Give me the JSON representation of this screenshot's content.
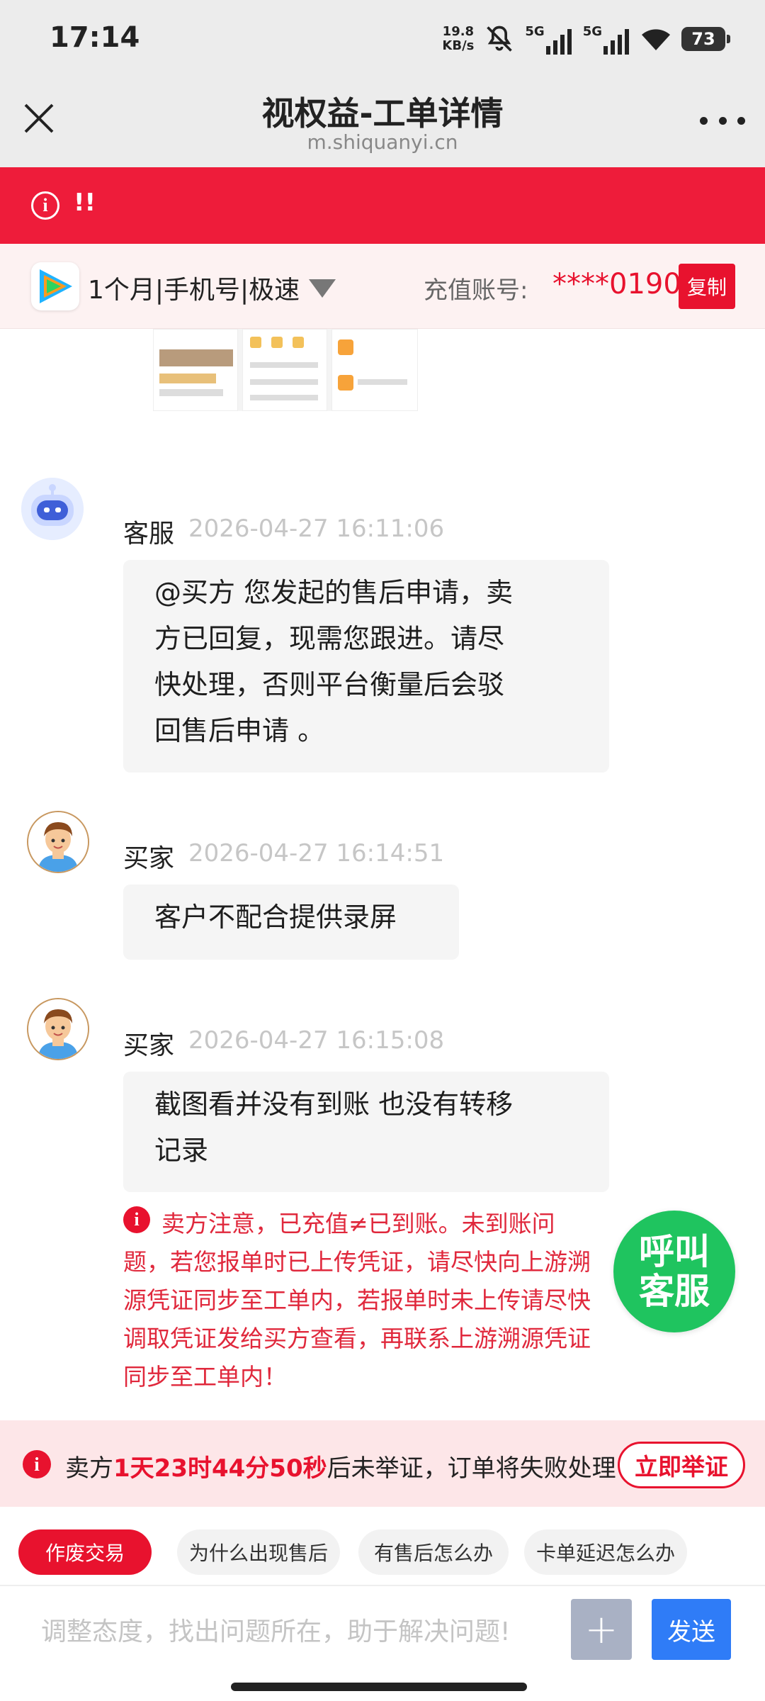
{
  "status_bar": {
    "time": "17:14",
    "net_speed_value": "19.8",
    "net_speed_unit": "KB/s",
    "sim1": "5G",
    "sim2": "5G",
    "battery": "73"
  },
  "header": {
    "title": "视权益-工单详情",
    "url": "m.shiquanyi.cn"
  },
  "alert": {
    "text": "!!"
  },
  "product": {
    "name": "1个月|手机号|极速",
    "account_label": "充值账号:",
    "account_value": "****0190",
    "copy_label": "复制"
  },
  "messages": [
    {
      "sender": "客服",
      "time": "2026-04-27 16:11:06",
      "lines": [
        "@买方 您发起的售后申请，卖",
        "方已回复，现需您跟进。请尽",
        "快处理，否则平台衡量后会驳",
        "回售后申请 。"
      ]
    },
    {
      "sender": "买家",
      "time": "2026-04-27 16:14:51",
      "lines": [
        "客户不配合提供录屏"
      ]
    },
    {
      "sender": "买家",
      "time": "2026-04-27 16:15:08",
      "lines": [
        "截图看并没有到账 也没有转移",
        "记录"
      ]
    }
  ],
  "warning": {
    "text": "卖方注意，已充值≠已到账。未到账问题，若您报单时已上传凭证，请尽快向上游溯源凭证同步至工单内，若报单时未上传请尽快调取凭证发给买方查看，再联系上游溯源凭证同步至工单内！"
  },
  "call_service": {
    "line1": "呼叫",
    "line2": "客服"
  },
  "countdown": {
    "prefix": "卖方",
    "remaining": "1天23时44分50秒",
    "suffix": "后未举证，订单将失败处理",
    "button": "立即举证"
  },
  "quick_chips": [
    "作废交易",
    "为什么出现售后",
    "有售后怎么办",
    "卡单延迟怎么办"
  ],
  "input": {
    "placeholder": "调整态度，找出问题所在，助于解决问题!",
    "send": "发送",
    "plus": "+"
  },
  "colors": {
    "accent_red": "#e8122e",
    "call_green": "#1fc45f",
    "send_blue": "#2f7cf7"
  }
}
